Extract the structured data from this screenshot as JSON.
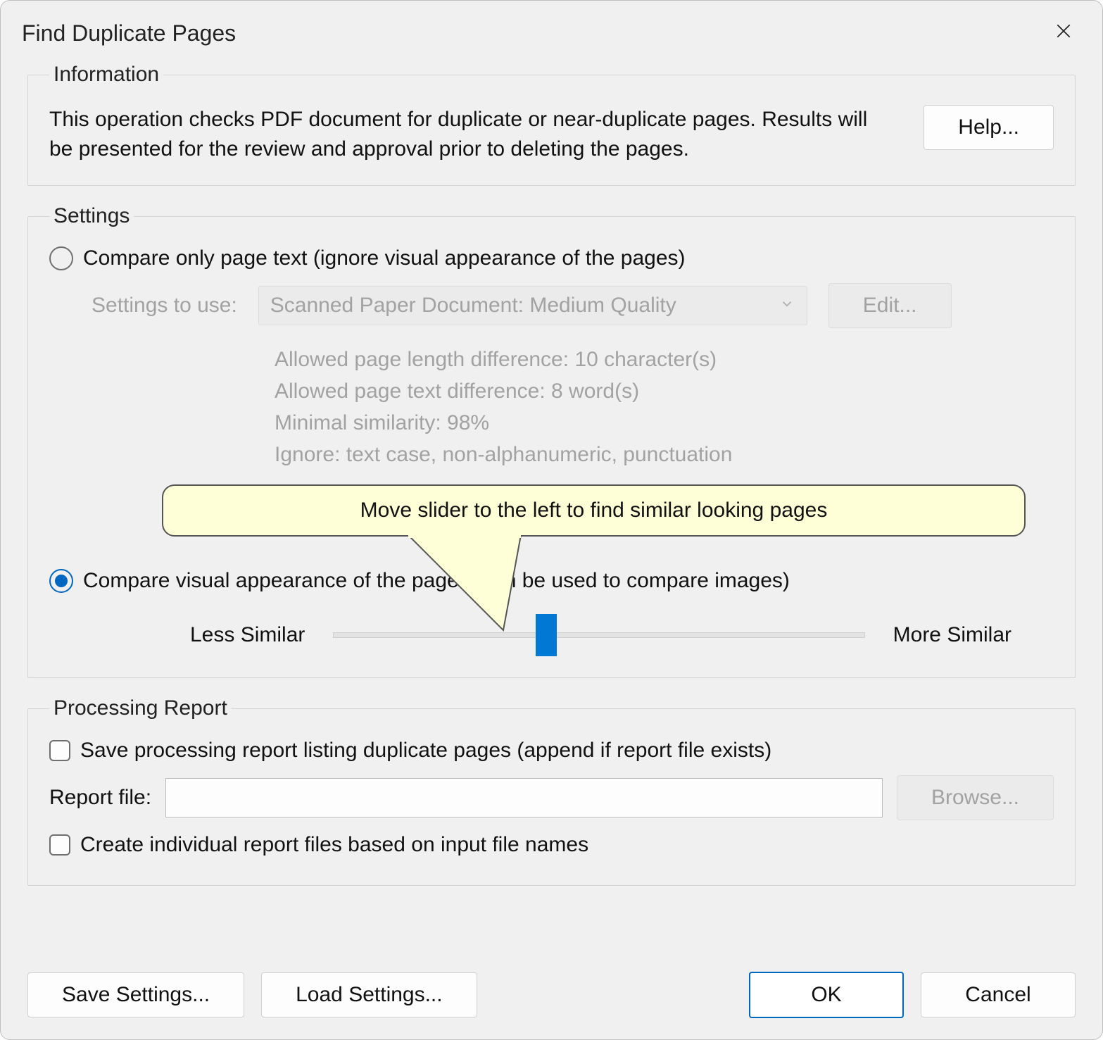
{
  "title": "Find Duplicate Pages",
  "information": {
    "legend": "Information",
    "text": "This operation checks PDF document for duplicate or near-duplicate pages. Results will be presented for the review and approval prior to deleting the pages.",
    "help_label": "Help..."
  },
  "settings": {
    "legend": "Settings",
    "option_text": {
      "label": "Compare only page text (ignore visual appearance of the pages)",
      "settings_to_use_label": "Settings to use:",
      "preset": "Scanned Paper Document: Medium Quality",
      "edit_label": "Edit...",
      "hints": {
        "line1": "Allowed page length difference: 10 character(s)",
        "line2": "Allowed page text difference: 8 word(s)",
        "line3": "Minimal similarity: 98%",
        "line4": "Ignore: text case, non-alphanumeric, punctuation"
      }
    },
    "callout_text": "Move slider to the left to find similar looking pages",
    "option_visual": {
      "label": "Compare visual appearance of the pages (can be used to compare images)",
      "less_label": "Less Similar",
      "more_label": "More Similar",
      "slider_percent": 40
    }
  },
  "report": {
    "legend": "Processing Report",
    "save_label": "Save processing report listing duplicate pages (append if report file exists)",
    "file_label": "Report file:",
    "file_value": "",
    "browse_label": "Browse...",
    "individual_label": "Create individual report files based on input file names"
  },
  "footer": {
    "save_settings": "Save Settings...",
    "load_settings": "Load Settings...",
    "ok": "OK",
    "cancel": "Cancel"
  }
}
